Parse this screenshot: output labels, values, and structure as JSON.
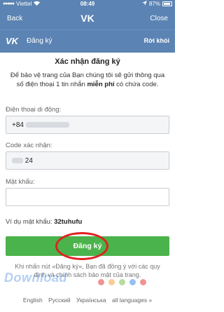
{
  "status_bar": {
    "carrier": "Viettel",
    "time": "08:49",
    "battery": "87%"
  },
  "nav": {
    "back": "Back",
    "title": "VK",
    "close": "Close"
  },
  "vk_bar": {
    "logo": "VK",
    "label": "Đăng ký",
    "exit": "Rời khỏi"
  },
  "page": {
    "heading": "Xác nhận đăng ký",
    "desc_part1": "Để bảo vệ trang của Bạn chúng tôi sẽ gửi thông qua số điện thoại 1 tin nhắn",
    "desc_bold": "miễn phí",
    "desc_part2": "có chứa code."
  },
  "form": {
    "phone_label": "Điện thoại di động:",
    "phone_prefix": "+84",
    "code_label": "Code xác nhận:",
    "code_suffix": "24",
    "password_label": "Mật khẩu:",
    "example_label": "Ví dụ mật khẩu:",
    "example_value": "32tuhufu",
    "submit": "Đăng ký"
  },
  "notice": "Khi nhấn nút «Đăng ký», Bạn đã đồng ý với các quy định và chính sách bảo mật của trang.",
  "watermark": "Download",
  "languages": [
    "English",
    "Русский",
    "Українська",
    "all languages »"
  ],
  "colors": {
    "header": "#5b83b3",
    "submit": "#4bb34b",
    "highlight": "#e02020"
  }
}
